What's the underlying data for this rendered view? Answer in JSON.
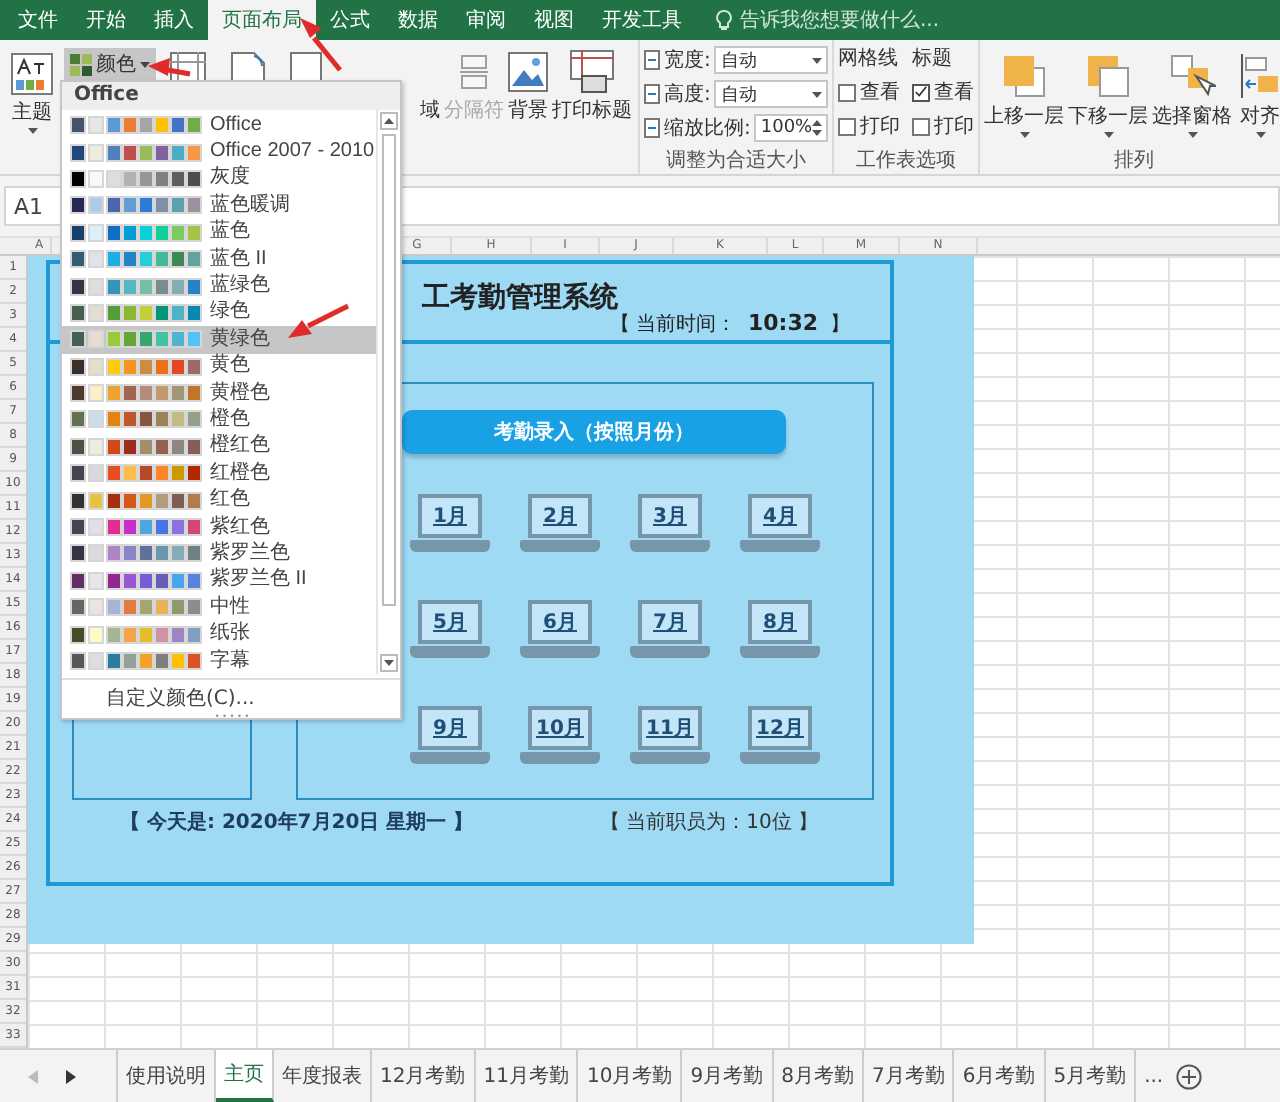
{
  "ribbon_tabs": [
    {
      "label": "文件",
      "selected": false
    },
    {
      "label": "开始",
      "selected": false
    },
    {
      "label": "插入",
      "selected": false
    },
    {
      "label": "页面布局",
      "selected": true
    },
    {
      "label": "公式",
      "selected": false
    },
    {
      "label": "数据",
      "selected": false
    },
    {
      "label": "审阅",
      "selected": false
    },
    {
      "label": "视图",
      "selected": false
    },
    {
      "label": "开发工具",
      "selected": false
    }
  ],
  "tell_me": {
    "placeholder": "告诉我您想要做什么..."
  },
  "themes_group": {
    "themes_button": "主题",
    "colors_button": "颜色"
  },
  "page_setup_group": {
    "buttons": [
      {
        "label": "域",
        "disabled": false,
        "kind": "text"
      },
      {
        "label": "分隔符",
        "disabled": true,
        "kind": "breaks"
      },
      {
        "label": "背景",
        "disabled": false,
        "kind": "background"
      },
      {
        "label": "打印标题",
        "disabled": false,
        "kind": "print-titles"
      }
    ]
  },
  "scale_group": {
    "title": "调整为合适大小",
    "fields": [
      {
        "label": "宽度:",
        "value": "自动",
        "kind": "select"
      },
      {
        "label": "高度:",
        "value": "自动",
        "kind": "select"
      },
      {
        "label": "缩放比例:",
        "value": "100%",
        "kind": "spinner"
      }
    ]
  },
  "sheet_options_group": {
    "title": "工作表选项",
    "columns": [
      {
        "heading": "网格线",
        "options": [
          {
            "label": "查看",
            "checked": false
          },
          {
            "label": "打印",
            "checked": false
          }
        ]
      },
      {
        "heading": "标题",
        "options": [
          {
            "label": "查看",
            "checked": true
          },
          {
            "label": "打印",
            "checked": false
          }
        ]
      }
    ]
  },
  "arrange_group": {
    "title": "排列",
    "buttons": [
      {
        "label": "上移一层",
        "kind": "forward"
      },
      {
        "label": "下移一层",
        "kind": "backward"
      },
      {
        "label": "选择窗格",
        "kind": "pane"
      },
      {
        "label": "对齐",
        "kind": "align"
      }
    ]
  },
  "colors_menu": {
    "heading": "Office",
    "items": [
      {
        "label": "Office",
        "selected": false,
        "swatches": [
          {
            "color": "#44546a"
          },
          {
            "color": "#e7e6e6"
          },
          {
            "color": "#5b9bd5"
          },
          {
            "color": "#ed7d31"
          },
          {
            "color": "#a5a5a5"
          },
          {
            "color": "#ffc000"
          },
          {
            "color": "#4472c4"
          },
          {
            "color": "#70ad47"
          }
        ]
      },
      {
        "label": "Office 2007 - 2010",
        "selected": false,
        "swatches": [
          {
            "color": "#1f497d"
          },
          {
            "color": "#eeece1"
          },
          {
            "color": "#4f81bd"
          },
          {
            "color": "#c0504d"
          },
          {
            "color": "#9bbb59"
          },
          {
            "color": "#8064a2"
          },
          {
            "color": "#4bacc6"
          },
          {
            "color": "#f79646"
          }
        ]
      },
      {
        "label": "灰度",
        "selected": false,
        "swatches": [
          {
            "color": "#000000"
          },
          {
            "color": "#f8f8f8"
          },
          {
            "color": "#dddddd"
          },
          {
            "color": "#b2b2b2"
          },
          {
            "color": "#969696"
          },
          {
            "color": "#808080"
          },
          {
            "color": "#5f5f5f"
          },
          {
            "color": "#4d4d4d"
          }
        ]
      },
      {
        "label": "蓝色暖调",
        "selected": false,
        "swatches": [
          {
            "color": "#242852"
          },
          {
            "color": "#acccea"
          },
          {
            "color": "#4a66ac"
          },
          {
            "color": "#629dd1"
          },
          {
            "color": "#297fd5"
          },
          {
            "color": "#7f8fa9"
          },
          {
            "color": "#5aa2ae"
          },
          {
            "color": "#9d90a0"
          }
        ]
      },
      {
        "label": "蓝色",
        "selected": false,
        "swatches": [
          {
            "color": "#17406d"
          },
          {
            "color": "#dbeff9"
          },
          {
            "color": "#0f6fc6"
          },
          {
            "color": "#009dd9"
          },
          {
            "color": "#0bd0d9"
          },
          {
            "color": "#10cf9b"
          },
          {
            "color": "#7cca62"
          },
          {
            "color": "#a5c249"
          }
        ]
      },
      {
        "label": "蓝色 II",
        "selected": false,
        "swatches": [
          {
            "color": "#335b74"
          },
          {
            "color": "#dfe3e5"
          },
          {
            "color": "#1cade4"
          },
          {
            "color": "#2683c6"
          },
          {
            "color": "#27ced7"
          },
          {
            "color": "#42ba97"
          },
          {
            "color": "#3e8853"
          },
          {
            "color": "#62a39f"
          }
        ]
      },
      {
        "label": "蓝绿色",
        "selected": false,
        "swatches": [
          {
            "color": "#373545"
          },
          {
            "color": "#dedede"
          },
          {
            "color": "#3494ba"
          },
          {
            "color": "#58b6c0"
          },
          {
            "color": "#75bda7"
          },
          {
            "color": "#7a8c8e"
          },
          {
            "color": "#84acb6"
          },
          {
            "color": "#2683c6"
          }
        ]
      },
      {
        "label": "绿色",
        "selected": false,
        "swatches": [
          {
            "color": "#455f51"
          },
          {
            "color": "#e3ded1"
          },
          {
            "color": "#549e39"
          },
          {
            "color": "#8ab833"
          },
          {
            "color": "#c0cf3a"
          },
          {
            "color": "#029676"
          },
          {
            "color": "#4ab5c4"
          },
          {
            "color": "#0989b1"
          }
        ]
      },
      {
        "label": "黄绿色",
        "selected": true,
        "swatches": [
          {
            "color": "#455f51"
          },
          {
            "color": "#e3ded1"
          },
          {
            "color": "#99cb38"
          },
          {
            "color": "#63a537"
          },
          {
            "color": "#37a76f"
          },
          {
            "color": "#44c1a3"
          },
          {
            "color": "#4eb3cf"
          },
          {
            "color": "#51c3f9"
          }
        ]
      },
      {
        "label": "黄色",
        "selected": false,
        "swatches": [
          {
            "color": "#39302a"
          },
          {
            "color": "#e5dec9"
          },
          {
            "color": "#ffca08"
          },
          {
            "color": "#f8931d"
          },
          {
            "color": "#ce8d3e"
          },
          {
            "color": "#ec7016"
          },
          {
            "color": "#e64823"
          },
          {
            "color": "#9c6a6a"
          }
        ]
      },
      {
        "label": "黄橙色",
        "selected": false,
        "swatches": [
          {
            "color": "#4e3b30"
          },
          {
            "color": "#fbeec9"
          },
          {
            "color": "#f0a22e"
          },
          {
            "color": "#a5644e"
          },
          {
            "color": "#b58b80"
          },
          {
            "color": "#c3986d"
          },
          {
            "color": "#a19574"
          },
          {
            "color": "#c17529"
          }
        ]
      },
      {
        "label": "橙色",
        "selected": false,
        "swatches": [
          {
            "color": "#637052"
          },
          {
            "color": "#ccddea"
          },
          {
            "color": "#e48312"
          },
          {
            "color": "#bd582c"
          },
          {
            "color": "#865640"
          },
          {
            "color": "#9b8357"
          },
          {
            "color": "#c2bc80"
          },
          {
            "color": "#94a088"
          }
        ]
      },
      {
        "label": "橙红色",
        "selected": false,
        "swatches": [
          {
            "color": "#505046"
          },
          {
            "color": "#eeece1"
          },
          {
            "color": "#d34817"
          },
          {
            "color": "#9b2d1f"
          },
          {
            "color": "#a28e6a"
          },
          {
            "color": "#956251"
          },
          {
            "color": "#918485"
          },
          {
            "color": "#855d5d"
          }
        ]
      },
      {
        "label": "红橙色",
        "selected": false,
        "swatches": [
          {
            "color": "#454551"
          },
          {
            "color": "#d8d9dc"
          },
          {
            "color": "#e84c22"
          },
          {
            "color": "#ffbd47"
          },
          {
            "color": "#b64926"
          },
          {
            "color": "#ff8427"
          },
          {
            "color": "#cc9900"
          },
          {
            "color": "#b22600"
          }
        ]
      },
      {
        "label": "红色",
        "selected": false,
        "swatches": [
          {
            "color": "#323232"
          },
          {
            "color": "#e5c243"
          },
          {
            "color": "#a5300f"
          },
          {
            "color": "#d55816"
          },
          {
            "color": "#e19825"
          },
          {
            "color": "#b19c7d"
          },
          {
            "color": "#7f5f52"
          },
          {
            "color": "#b27d49"
          }
        ]
      },
      {
        "label": "紫红色",
        "selected": false,
        "swatches": [
          {
            "color": "#454551"
          },
          {
            "color": "#e3dced"
          },
          {
            "color": "#e32d91"
          },
          {
            "color": "#c830cc"
          },
          {
            "color": "#4ea6dc"
          },
          {
            "color": "#4775e7"
          },
          {
            "color": "#8971e1"
          },
          {
            "color": "#d54773"
          }
        ]
      },
      {
        "label": "紫罗兰色",
        "selected": false,
        "swatches": [
          {
            "color": "#373545"
          },
          {
            "color": "#dcd8dc"
          },
          {
            "color": "#ad84c6"
          },
          {
            "color": "#8784c7"
          },
          {
            "color": "#5d739a"
          },
          {
            "color": "#6997af"
          },
          {
            "color": "#84acb6"
          },
          {
            "color": "#6f8183"
          }
        ]
      },
      {
        "label": "紫罗兰色 II",
        "selected": false,
        "swatches": [
          {
            "color": "#632e62"
          },
          {
            "color": "#eae5eb"
          },
          {
            "color": "#92278f"
          },
          {
            "color": "#9b57d3"
          },
          {
            "color": "#755dd9"
          },
          {
            "color": "#665eb8"
          },
          {
            "color": "#45a5ed"
          },
          {
            "color": "#5982db"
          }
        ]
      },
      {
        "label": "中性",
        "selected": false,
        "swatches": [
          {
            "color": "#696464"
          },
          {
            "color": "#e9e5dc"
          },
          {
            "color": "#a5b4d5"
          },
          {
            "color": "#e07c3f"
          },
          {
            "color": "#a4a56f"
          },
          {
            "color": "#e7b25a"
          },
          {
            "color": "#8e9a6d"
          },
          {
            "color": "#8c8c8c"
          }
        ]
      },
      {
        "label": "纸张",
        "selected": false,
        "swatches": [
          {
            "color": "#444d26"
          },
          {
            "color": "#fefac9"
          },
          {
            "color": "#a5b592"
          },
          {
            "color": "#f3a447"
          },
          {
            "color": "#e7bc29"
          },
          {
            "color": "#d092a7"
          },
          {
            "color": "#9c85c0"
          },
          {
            "color": "#809ec2"
          }
        ]
      },
      {
        "label": "字幕",
        "selected": false,
        "swatches": [
          {
            "color": "#575757"
          },
          {
            "color": "#dddddd"
          },
          {
            "color": "#2c7c9f"
          },
          {
            "color": "#93a299"
          },
          {
            "color": "#f2a12a"
          },
          {
            "color": "#7f7f7f"
          },
          {
            "color": "#ffc000"
          },
          {
            "color": "#db5329"
          }
        ]
      }
    ],
    "custom": "自定义颜色(C)..."
  },
  "name_box": {
    "value": "A1"
  },
  "column_headers": [
    "A",
    "G",
    "H",
    "I",
    "J",
    "K",
    "L",
    "M",
    "N"
  ],
  "row_headers": [
    "1",
    "2",
    "3",
    "4",
    "5",
    "6",
    "7",
    "8",
    "9",
    "10",
    "11",
    "12",
    "13",
    "14",
    "15",
    "16",
    "17",
    "18",
    "19",
    "20",
    "21",
    "22",
    "23",
    "24",
    "25",
    "26",
    "27",
    "28",
    "29",
    "30",
    "31",
    "32",
    "33"
  ],
  "dashboard": {
    "title": "工考勤管理系统",
    "time_label": "【 当前时间：",
    "time": "10:32",
    "time_end": "】",
    "entry_button": "考勤录入（按照月份）",
    "months": [
      "1月",
      "2月",
      "3月",
      "4月",
      "5月",
      "6月",
      "7月",
      "8月",
      "9月",
      "10月",
      "11月",
      "12月"
    ],
    "today": "【 今天是: 2020年7月20日 星期一 】",
    "staff": "【 当前职员为：10位 】"
  },
  "sheet_tabs": [
    {
      "label": "使用说明",
      "selected": false
    },
    {
      "label": "主页",
      "selected": true
    },
    {
      "label": "年度报表",
      "selected": false
    },
    {
      "label": "12月考勤",
      "selected": false
    },
    {
      "label": "11月考勤",
      "selected": false
    },
    {
      "label": "10月考勤",
      "selected": false
    },
    {
      "label": "9月考勤",
      "selected": false
    },
    {
      "label": "8月考勤",
      "selected": false
    },
    {
      "label": "7月考勤",
      "selected": false
    },
    {
      "label": "6月考勤",
      "selected": false
    },
    {
      "label": "5月考勤",
      "selected": false
    }
  ],
  "sheet_tabs_more": "..."
}
